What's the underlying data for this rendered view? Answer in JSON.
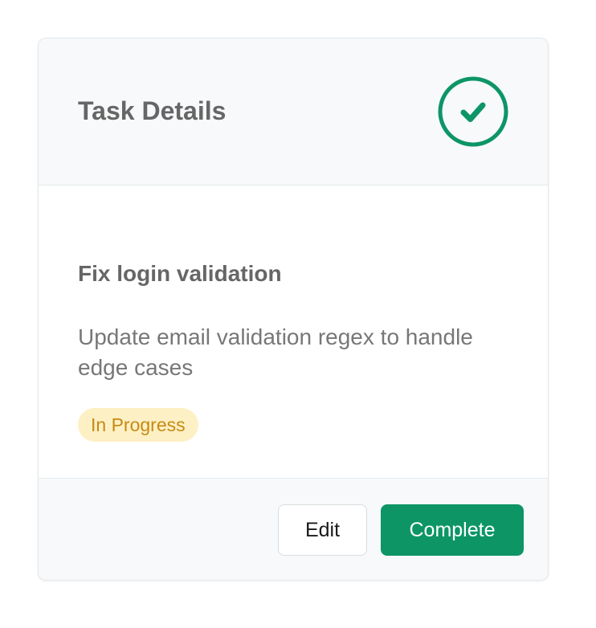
{
  "header": {
    "title": "Task Details",
    "status_icon": "check-circle-icon",
    "status_color": "#0d9566"
  },
  "task": {
    "name": "Fix login validation",
    "description": "Update email validation regex to handle edge cases",
    "status": "In Progress",
    "status_colors": {
      "background": "#fdf0c4",
      "text": "#c78a14"
    }
  },
  "footer": {
    "edit_label": "Edit",
    "complete_label": "Complete",
    "accent_color": "#0d9566"
  }
}
